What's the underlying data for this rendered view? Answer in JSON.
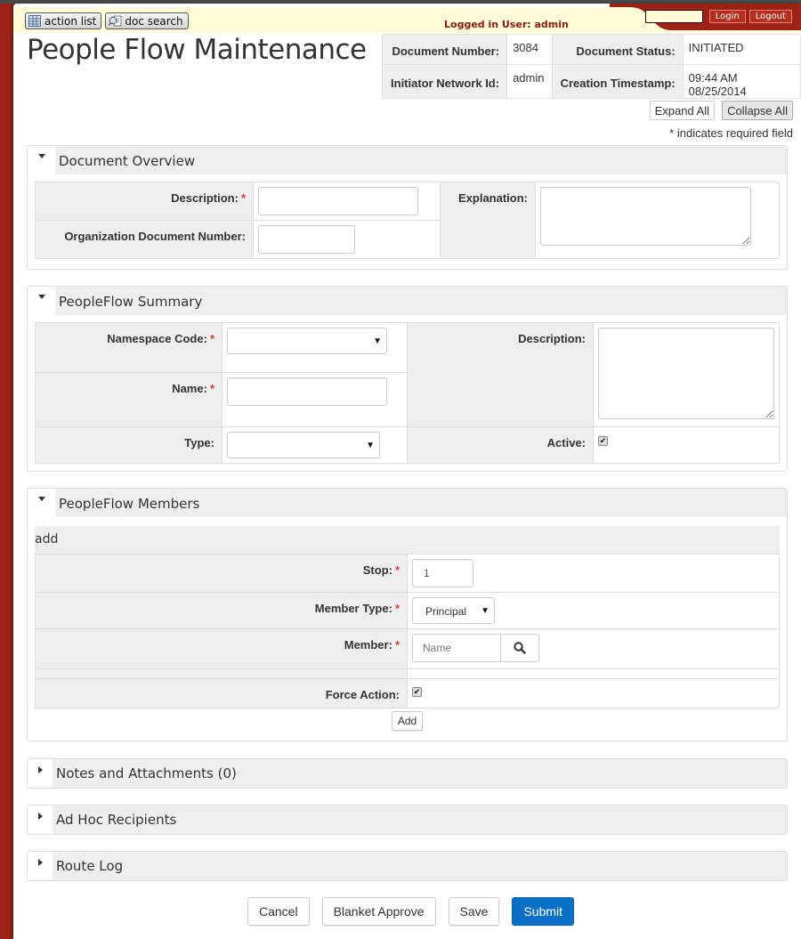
{
  "header": {
    "nav_buttons": [
      {
        "label": "action list",
        "icon": "list-icon"
      },
      {
        "label": "doc search",
        "icon": "doc-search-icon"
      }
    ],
    "logged_in_text": "Logged in User: admin",
    "login_input_value": "",
    "login_label": "Login",
    "logout_label": "Logout"
  },
  "page_title": "People Flow Maintenance",
  "doc_info": {
    "doc_number_label": "Document Number:",
    "doc_number": "3084",
    "doc_status_label": "Document Status:",
    "doc_status": "INITIATED",
    "initiator_label": "Initiator Network Id:",
    "initiator": "admin",
    "created_label": "Creation Timestamp:",
    "created": "09:44 AM 08/25/2014"
  },
  "toolbar": {
    "expand_all": "Expand All",
    "collapse_all": "Collapse All",
    "required_note": "* indicates required field"
  },
  "sections": {
    "overview": {
      "title": "Document Overview",
      "expanded": true,
      "description_label": "Description:",
      "description_value": "",
      "org_doc_number_label": "Organization Document Number:",
      "org_doc_number_value": "",
      "explanation_label": "Explanation:",
      "explanation_value": ""
    },
    "summary": {
      "title": "PeopleFlow Summary",
      "expanded": true,
      "namespace_label": "Namespace Code:",
      "namespace_value": "",
      "name_label": "Name:",
      "name_value": "",
      "type_label": "Type:",
      "type_value": "",
      "description_label": "Description:",
      "description_value": "",
      "active_label": "Active:",
      "active_checked": true
    },
    "members": {
      "title": "PeopleFlow Members",
      "expanded": true,
      "add_header": "add",
      "stop_label": "Stop:",
      "stop_value": "1",
      "member_type_label": "Member Type:",
      "member_type_value": "Principal",
      "member_label": "Member:",
      "member_placeholder": "Name",
      "force_action_label": "Force Action:",
      "force_action_checked": true,
      "add_button": "Add"
    },
    "notes": {
      "title": "Notes and Attachments (0)",
      "expanded": false
    },
    "adhoc": {
      "title": "Ad Hoc Recipients",
      "expanded": false
    },
    "routelog": {
      "title": "Route Log",
      "expanded": false
    }
  },
  "footer": {
    "cancel": "Cancel",
    "blanket_approve": "Blanket Approve",
    "save": "Save",
    "submit": "Submit"
  },
  "colors": {
    "brand_red": "#9b2316",
    "header_cream": "#fffbd6",
    "primary_blue": "#0b6fc6",
    "required_red": "#d43f3a"
  }
}
